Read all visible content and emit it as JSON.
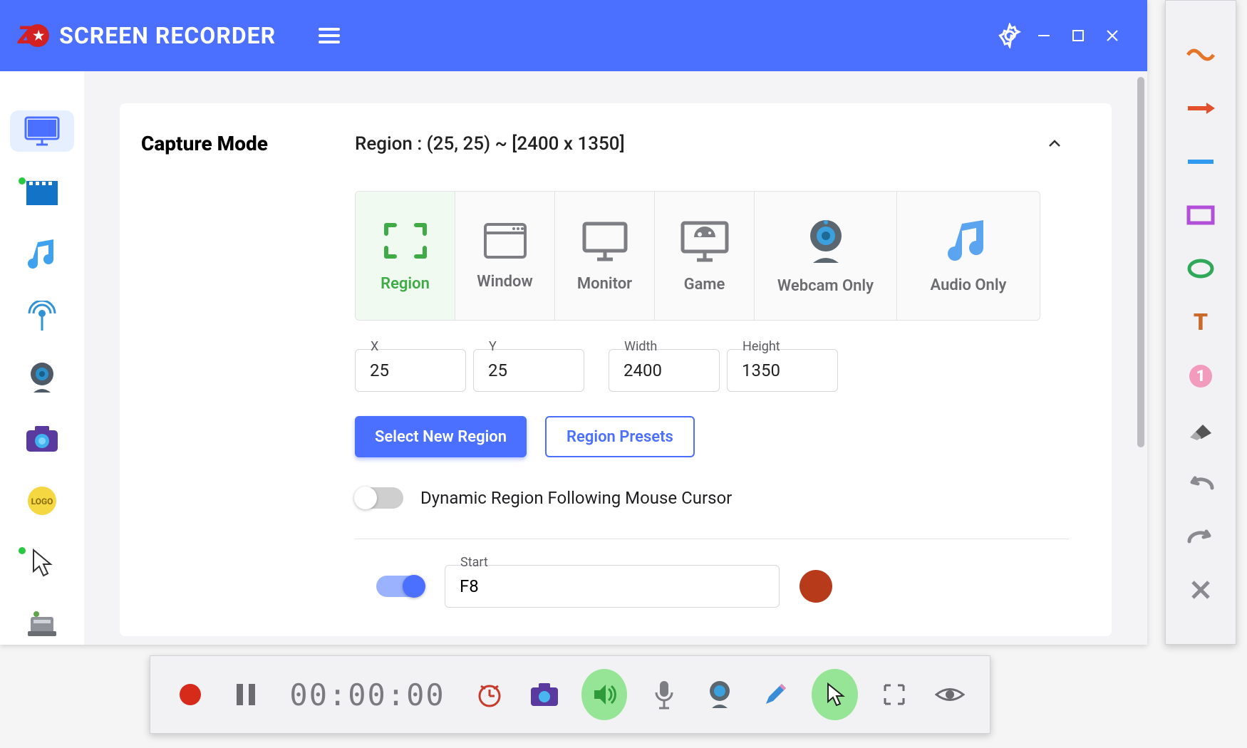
{
  "app_title": "SCREEN RECORDER",
  "capture": {
    "section_title": "Capture Mode",
    "summary": "Region : (25, 25) ~ [2400 x 1350]",
    "modes": {
      "region": "Region",
      "window": "Window",
      "monitor": "Monitor",
      "game": "Game",
      "webcam": "Webcam Only",
      "audio": "Audio Only"
    },
    "fields": {
      "x_label": "X",
      "x": "25",
      "y_label": "Y",
      "y": "25",
      "w_label": "Width",
      "w": "2400",
      "h_label": "Height",
      "h": "1350"
    },
    "select_region_btn": "Select New Region",
    "presets_btn": "Region Presets",
    "dynamic_label": "Dynamic Region Following Mouse Cursor",
    "hotkey": {
      "label": "Start",
      "value": "F8"
    }
  },
  "timer": "00:00:00"
}
